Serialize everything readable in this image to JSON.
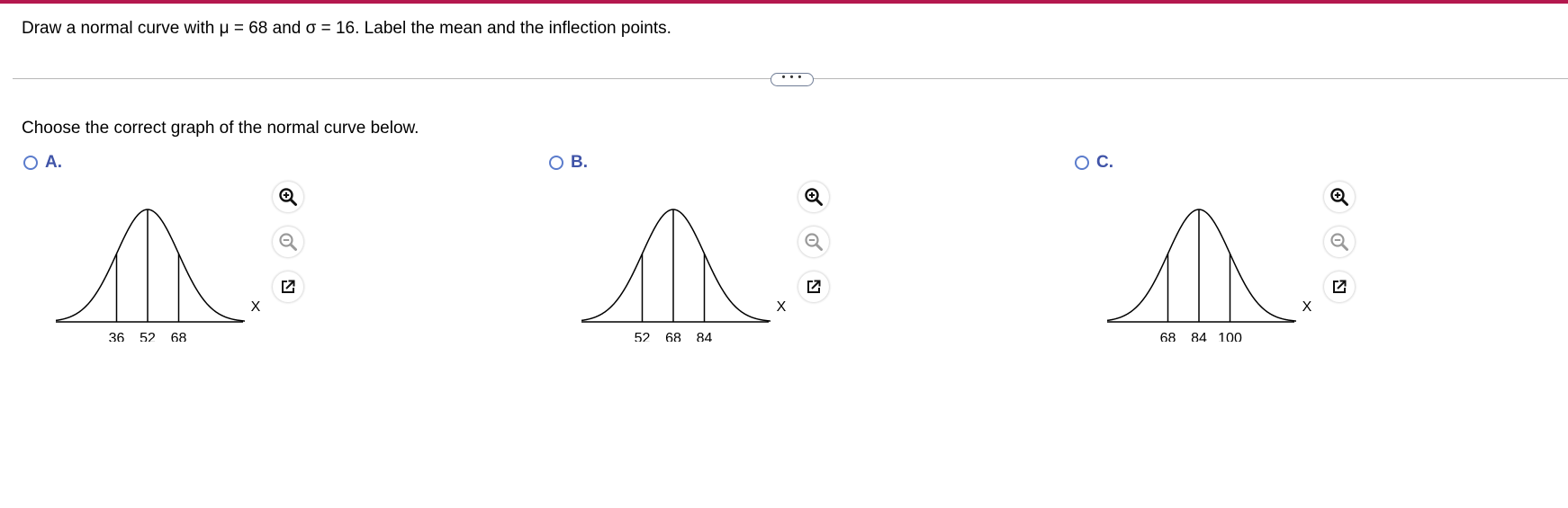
{
  "colors": {
    "accent_bar": "#b4184e",
    "radio": "#5b7ccc",
    "option_letter": "#4054a8"
  },
  "question": "Draw a normal curve with μ = 68 and σ = 16. Label the mean and the inflection points.",
  "expand_label": "• • •",
  "prompt": "Choose the correct graph of the normal curve below.",
  "options": [
    {
      "letter": "A.",
      "selected": false,
      "x_axis_label": "X",
      "tick_labels": [
        "36",
        "52",
        "68"
      ]
    },
    {
      "letter": "B.",
      "selected": false,
      "x_axis_label": "X",
      "tick_labels": [
        "52",
        "68",
        "84"
      ]
    },
    {
      "letter": "C.",
      "selected": false,
      "x_axis_label": "X",
      "tick_labels": [
        "68",
        "84",
        "100"
      ]
    }
  ],
  "tools": [
    "zoom-in-icon",
    "zoom-out-icon",
    "popout-icon"
  ]
}
